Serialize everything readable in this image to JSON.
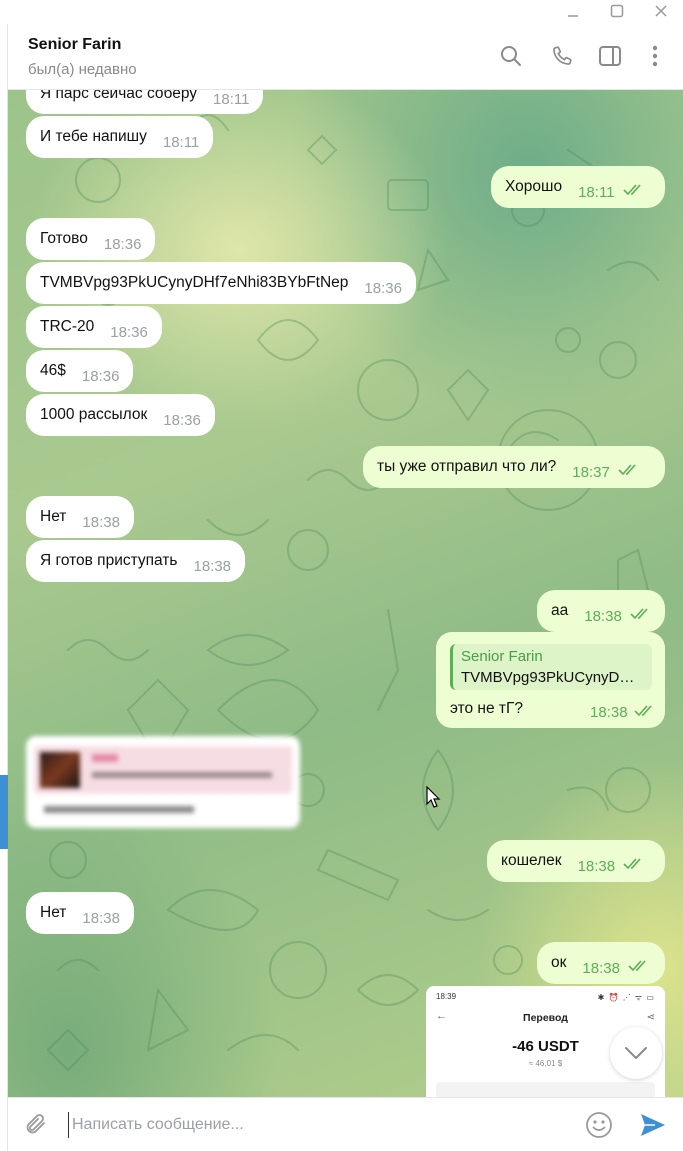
{
  "header": {
    "name": "Senior Farin",
    "status": "был(а) недавно"
  },
  "messages": [
    {
      "dir": "in",
      "text": "Я парс сейчас соберу",
      "time": "18:11"
    },
    {
      "dir": "in",
      "text": "И тебе напишу",
      "time": "18:11"
    },
    {
      "dir": "out",
      "text": "Хорошо",
      "time": "18:11",
      "read": true
    },
    {
      "dir": "in",
      "text": "Готово",
      "time": "18:36"
    },
    {
      "dir": "in",
      "text": "TVMBVpg93PkUCynyDHf7eNhi83BYbFtNep",
      "time": "18:36"
    },
    {
      "dir": "in",
      "text": "TRC-20",
      "time": "18:36"
    },
    {
      "dir": "in",
      "text": "46$",
      "time": "18:36"
    },
    {
      "dir": "in",
      "text": "1000 рассылок",
      "time": "18:36"
    },
    {
      "dir": "out",
      "text": "ты уже отправил что ли?",
      "time": "18:37",
      "read": true
    },
    {
      "dir": "in",
      "text": "Нет",
      "time": "18:38"
    },
    {
      "dir": "in",
      "text": "Я готов приступать",
      "time": "18:38"
    },
    {
      "dir": "out",
      "text": "аа",
      "time": "18:38",
      "read": true
    },
    {
      "dir": "out",
      "text": "кошелек",
      "time": "18:38",
      "read": true
    },
    {
      "dir": "in",
      "text": "Нет",
      "time": "18:38"
    },
    {
      "dir": "out",
      "text": "ок",
      "time": "18:38",
      "read": true
    }
  ],
  "reply_message": {
    "quote_author": "Senior Farin",
    "quote_text": "TVMBVpg93PkUCynyD…",
    "text": "это не тГ?",
    "time": "18:38"
  },
  "transfer_screenshot": {
    "status_time": "18:39",
    "status_icons": "✱ ⏰ ⋰ ᯤ ▭",
    "back": "←",
    "title": "Перевод",
    "share": "⋖",
    "amount": "-46 USDT",
    "sub_amount": "≈ 46,01 $"
  },
  "composer": {
    "placeholder": "Написать сообщение..."
  },
  "colors": {
    "bubble_in": "#ffffff",
    "bubble_out": "#eefed3",
    "time_out": "#5fad56",
    "accent": "#3d8fd6",
    "send": "#3d8fd6"
  },
  "icons": [
    "search-icon",
    "phone-icon",
    "sidebar-toggle-icon",
    "more-vertical-icon",
    "attach-icon",
    "emoji-icon",
    "send-icon",
    "chevron-down-icon",
    "minimize-icon",
    "maximize-icon",
    "close-icon"
  ]
}
